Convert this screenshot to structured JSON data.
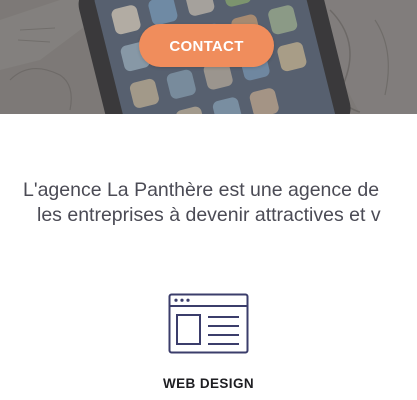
{
  "hero": {
    "contact_label": "CONTACT"
  },
  "intro": {
    "line1": "L'agence La Panthère est une agence de",
    "line2": "les entreprises à devenir attractives et v"
  },
  "service": {
    "title": "WEB DESIGN",
    "icon": "browser-layout-icon"
  },
  "colors": {
    "accent": "#f08d5c",
    "icon": "#3b3d6b",
    "text": "#4b4b55"
  }
}
